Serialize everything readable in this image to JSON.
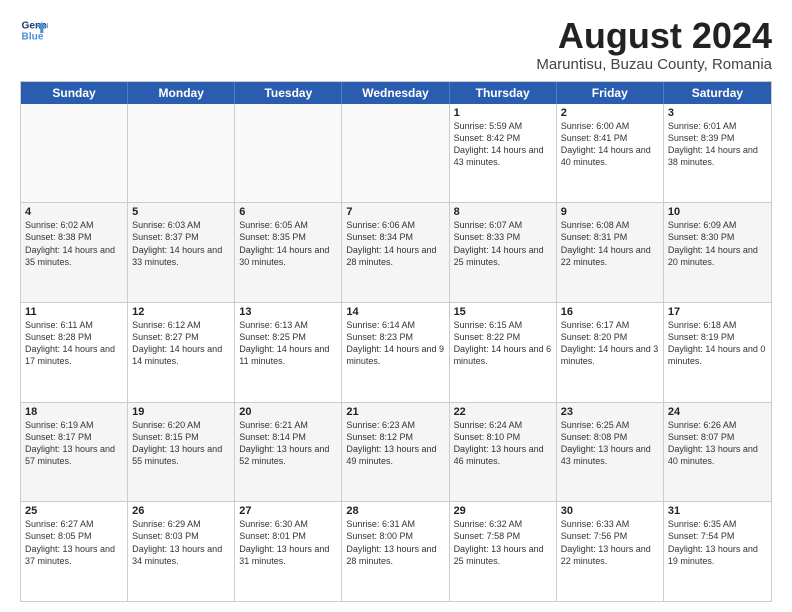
{
  "logo": {
    "line1": "General",
    "line2": "Blue"
  },
  "title": "August 2024",
  "subtitle": "Maruntisu, Buzau County, Romania",
  "header_days": [
    "Sunday",
    "Monday",
    "Tuesday",
    "Wednesday",
    "Thursday",
    "Friday",
    "Saturday"
  ],
  "weeks": [
    [
      {
        "day": "",
        "sunrise": "",
        "sunset": "",
        "daylight": "",
        "empty": true
      },
      {
        "day": "",
        "sunrise": "",
        "sunset": "",
        "daylight": "",
        "empty": true
      },
      {
        "day": "",
        "sunrise": "",
        "sunset": "",
        "daylight": "",
        "empty": true
      },
      {
        "day": "",
        "sunrise": "",
        "sunset": "",
        "daylight": "",
        "empty": true
      },
      {
        "day": "1",
        "sunrise": "Sunrise: 5:59 AM",
        "sunset": "Sunset: 8:42 PM",
        "daylight": "Daylight: 14 hours and 43 minutes."
      },
      {
        "day": "2",
        "sunrise": "Sunrise: 6:00 AM",
        "sunset": "Sunset: 8:41 PM",
        "daylight": "Daylight: 14 hours and 40 minutes."
      },
      {
        "day": "3",
        "sunrise": "Sunrise: 6:01 AM",
        "sunset": "Sunset: 8:39 PM",
        "daylight": "Daylight: 14 hours and 38 minutes."
      }
    ],
    [
      {
        "day": "4",
        "sunrise": "Sunrise: 6:02 AM",
        "sunset": "Sunset: 8:38 PM",
        "daylight": "Daylight: 14 hours and 35 minutes."
      },
      {
        "day": "5",
        "sunrise": "Sunrise: 6:03 AM",
        "sunset": "Sunset: 8:37 PM",
        "daylight": "Daylight: 14 hours and 33 minutes."
      },
      {
        "day": "6",
        "sunrise": "Sunrise: 6:05 AM",
        "sunset": "Sunset: 8:35 PM",
        "daylight": "Daylight: 14 hours and 30 minutes."
      },
      {
        "day": "7",
        "sunrise": "Sunrise: 6:06 AM",
        "sunset": "Sunset: 8:34 PM",
        "daylight": "Daylight: 14 hours and 28 minutes."
      },
      {
        "day": "8",
        "sunrise": "Sunrise: 6:07 AM",
        "sunset": "Sunset: 8:33 PM",
        "daylight": "Daylight: 14 hours and 25 minutes."
      },
      {
        "day": "9",
        "sunrise": "Sunrise: 6:08 AM",
        "sunset": "Sunset: 8:31 PM",
        "daylight": "Daylight: 14 hours and 22 minutes."
      },
      {
        "day": "10",
        "sunrise": "Sunrise: 6:09 AM",
        "sunset": "Sunset: 8:30 PM",
        "daylight": "Daylight: 14 hours and 20 minutes."
      }
    ],
    [
      {
        "day": "11",
        "sunrise": "Sunrise: 6:11 AM",
        "sunset": "Sunset: 8:28 PM",
        "daylight": "Daylight: 14 hours and 17 minutes."
      },
      {
        "day": "12",
        "sunrise": "Sunrise: 6:12 AM",
        "sunset": "Sunset: 8:27 PM",
        "daylight": "Daylight: 14 hours and 14 minutes."
      },
      {
        "day": "13",
        "sunrise": "Sunrise: 6:13 AM",
        "sunset": "Sunset: 8:25 PM",
        "daylight": "Daylight: 14 hours and 11 minutes."
      },
      {
        "day": "14",
        "sunrise": "Sunrise: 6:14 AM",
        "sunset": "Sunset: 8:23 PM",
        "daylight": "Daylight: 14 hours and 9 minutes."
      },
      {
        "day": "15",
        "sunrise": "Sunrise: 6:15 AM",
        "sunset": "Sunset: 8:22 PM",
        "daylight": "Daylight: 14 hours and 6 minutes."
      },
      {
        "day": "16",
        "sunrise": "Sunrise: 6:17 AM",
        "sunset": "Sunset: 8:20 PM",
        "daylight": "Daylight: 14 hours and 3 minutes."
      },
      {
        "day": "17",
        "sunrise": "Sunrise: 6:18 AM",
        "sunset": "Sunset: 8:19 PM",
        "daylight": "Daylight: 14 hours and 0 minutes."
      }
    ],
    [
      {
        "day": "18",
        "sunrise": "Sunrise: 6:19 AM",
        "sunset": "Sunset: 8:17 PM",
        "daylight": "Daylight: 13 hours and 57 minutes."
      },
      {
        "day": "19",
        "sunrise": "Sunrise: 6:20 AM",
        "sunset": "Sunset: 8:15 PM",
        "daylight": "Daylight: 13 hours and 55 minutes."
      },
      {
        "day": "20",
        "sunrise": "Sunrise: 6:21 AM",
        "sunset": "Sunset: 8:14 PM",
        "daylight": "Daylight: 13 hours and 52 minutes."
      },
      {
        "day": "21",
        "sunrise": "Sunrise: 6:23 AM",
        "sunset": "Sunset: 8:12 PM",
        "daylight": "Daylight: 13 hours and 49 minutes."
      },
      {
        "day": "22",
        "sunrise": "Sunrise: 6:24 AM",
        "sunset": "Sunset: 8:10 PM",
        "daylight": "Daylight: 13 hours and 46 minutes."
      },
      {
        "day": "23",
        "sunrise": "Sunrise: 6:25 AM",
        "sunset": "Sunset: 8:08 PM",
        "daylight": "Daylight: 13 hours and 43 minutes."
      },
      {
        "day": "24",
        "sunrise": "Sunrise: 6:26 AM",
        "sunset": "Sunset: 8:07 PM",
        "daylight": "Daylight: 13 hours and 40 minutes."
      }
    ],
    [
      {
        "day": "25",
        "sunrise": "Sunrise: 6:27 AM",
        "sunset": "Sunset: 8:05 PM",
        "daylight": "Daylight: 13 hours and 37 minutes."
      },
      {
        "day": "26",
        "sunrise": "Sunrise: 6:29 AM",
        "sunset": "Sunset: 8:03 PM",
        "daylight": "Daylight: 13 hours and 34 minutes."
      },
      {
        "day": "27",
        "sunrise": "Sunrise: 6:30 AM",
        "sunset": "Sunset: 8:01 PM",
        "daylight": "Daylight: 13 hours and 31 minutes."
      },
      {
        "day": "28",
        "sunrise": "Sunrise: 6:31 AM",
        "sunset": "Sunset: 8:00 PM",
        "daylight": "Daylight: 13 hours and 28 minutes."
      },
      {
        "day": "29",
        "sunrise": "Sunrise: 6:32 AM",
        "sunset": "Sunset: 7:58 PM",
        "daylight": "Daylight: 13 hours and 25 minutes."
      },
      {
        "day": "30",
        "sunrise": "Sunrise: 6:33 AM",
        "sunset": "Sunset: 7:56 PM",
        "daylight": "Daylight: 13 hours and 22 minutes."
      },
      {
        "day": "31",
        "sunrise": "Sunrise: 6:35 AM",
        "sunset": "Sunset: 7:54 PM",
        "daylight": "Daylight: 13 hours and 19 minutes."
      }
    ]
  ]
}
